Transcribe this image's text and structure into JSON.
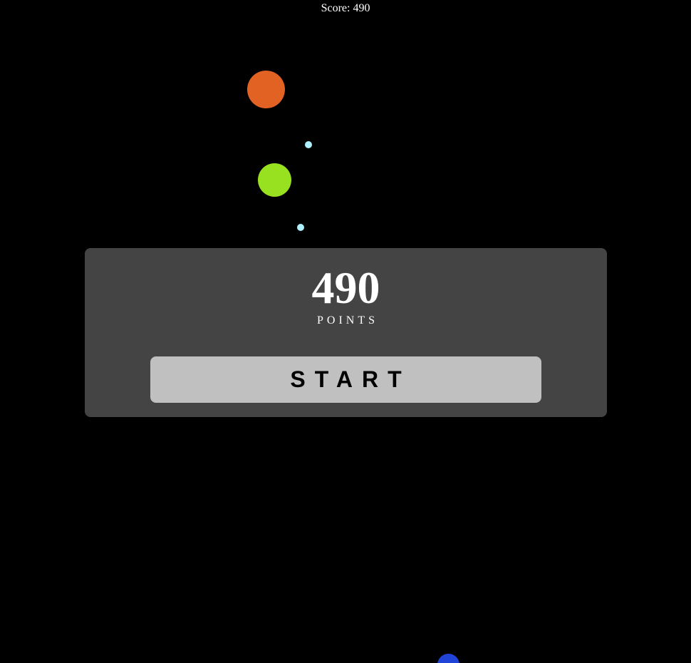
{
  "hud": {
    "score_text": "Score: 490"
  },
  "modal": {
    "score_value": "490",
    "points_label": "POINTS",
    "start_label": "START"
  },
  "colors": {
    "background": "#000000",
    "enemy_orange": "#e26224",
    "enemy_green": "#98e120",
    "projectile": "#aef0ff",
    "player_blue": "#2043d8",
    "modal_bg": "#444444",
    "button_bg": "#c0c0c0"
  }
}
